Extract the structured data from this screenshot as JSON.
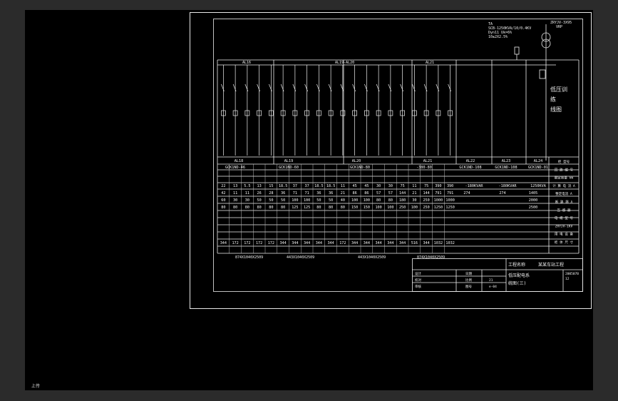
{
  "drawing": {
    "transformer": {
      "label_line1": "TA",
      "label_line2": "SCB-1250KVA/10/0.4KV",
      "label_line3": "Dyn11  Uk=6%",
      "label_line4": "10±2X2.5%",
      "cable": "ZRYJV-3X95",
      "cable_suffix": "VRP"
    },
    "panel_header_names": [
      "AL16",
      "AL19-AL20",
      "AL21"
    ],
    "title_big": [
      "低压训",
      "练",
      "线图"
    ],
    "panels": [
      "AL18",
      "AL19",
      "AL20",
      "AL21",
      "AL22",
      "AL23",
      "AL24"
    ],
    "cabinet_types": [
      "GCK1ND-46",
      "GCK1ND-60",
      "GCK1ND-80",
      "-380-80",
      "GCK1ND-108",
      "GCK1ND-108",
      "GCK1ND-01"
    ],
    "row1": [
      "22",
      "13",
      "5.5",
      "13",
      "15",
      "18.5",
      "37",
      "37",
      "18.5",
      "18.5",
      "11",
      "45",
      "45",
      "30",
      "30",
      "75",
      "11",
      "75",
      "390",
      "390"
    ],
    "row2": [
      "42",
      "11",
      "11",
      "26",
      "28",
      "36",
      "71",
      "71",
      "36",
      "36",
      "21",
      "86",
      "86",
      "57",
      "57",
      "144",
      "21",
      "144",
      "791",
      "791"
    ],
    "row3": [
      "60",
      "30",
      "30",
      "50",
      "50",
      "50",
      "100",
      "100",
      "50",
      "50",
      "40",
      "100",
      "100",
      "80",
      "80",
      "180",
      "30",
      "250",
      "1000",
      "1000"
    ],
    "row4": [
      "80",
      "80",
      "80",
      "80",
      "80",
      "80",
      "125",
      "125",
      "80",
      "80",
      "80",
      "150",
      "150",
      "100",
      "100",
      "250",
      "100",
      "250",
      "1250",
      "1250"
    ],
    "row_last": [
      "344",
      "172",
      "172",
      "172",
      "172",
      "344",
      "344",
      "344",
      "344",
      "344",
      "172",
      "344",
      "344",
      "344",
      "344",
      "344",
      "516",
      "344",
      "1032",
      "1032"
    ],
    "cap_text": [
      "-180KVAR",
      "-180KVAR",
      "1250KVA"
    ],
    "cap_values": [
      "274",
      "274",
      "1405",
      "2000",
      "2500"
    ],
    "dims": [
      "874X1040X2509",
      "443X1040X2509",
      "443X1040X2509",
      "874X1040X2509"
    ],
    "right_labels": [
      "柜 型号",
      "回 路 编 号",
      "额定容量 kW",
      "计 算 电 流 A",
      "整定电流 A",
      "断 路 器 A",
      "互 感 器",
      "电 缆 型 号",
      "ZRYJV-1KV",
      "用 电 设 备",
      "柜 体 尺 寸"
    ],
    "title_block": {
      "project_label": "工程名称",
      "project_name": "某某车站工程",
      "drawing_name_1": "低压配电系",
      "drawing_name_2": "统图(三)",
      "drawing_no": "200507B",
      "sheet": "12",
      "row_labels": [
        "设计",
        "校对",
        "审核"
      ],
      "mid_labels": [
        "日期",
        "比例",
        "图号"
      ],
      "mid_values": [
        "",
        "21",
        "e-04"
      ]
    },
    "command_line": "上传"
  }
}
